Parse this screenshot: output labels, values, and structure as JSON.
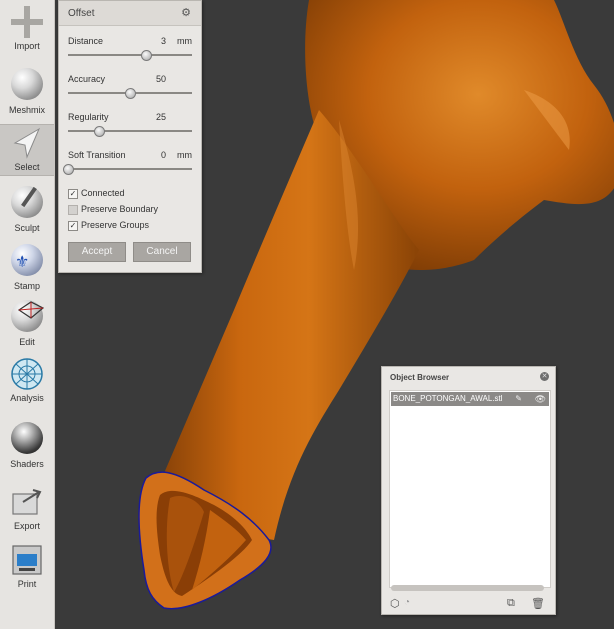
{
  "toolbar": {
    "items": [
      {
        "label": "Import",
        "icon": "plus-icon"
      },
      {
        "label": "Meshmix",
        "icon": "meshmix-icon"
      },
      {
        "label": "Select",
        "icon": "select-arrow-icon",
        "active": true
      },
      {
        "label": "Sculpt",
        "icon": "sculpt-brush-icon"
      },
      {
        "label": "Stamp",
        "icon": "stamp-icon"
      },
      {
        "label": "Edit",
        "icon": "edit-icon"
      },
      {
        "label": "Analysis",
        "icon": "analysis-icon"
      },
      {
        "label": "Shaders",
        "icon": "shaders-icon"
      },
      {
        "label": "Export",
        "icon": "export-icon"
      },
      {
        "label": "Print",
        "icon": "print-icon"
      }
    ]
  },
  "offset_panel": {
    "title": "Offset",
    "settings_icon": "gear-icon",
    "params": [
      {
        "name": "Distance",
        "value": "3",
        "unit": "mm",
        "level": 0.63
      },
      {
        "name": "Accuracy",
        "value": "50",
        "unit": "",
        "level": 0.5
      },
      {
        "name": "Regularity",
        "value": "25",
        "unit": "",
        "level": 0.25
      },
      {
        "name": "Soft Transition",
        "value": "0",
        "unit": "mm",
        "level": 0.0
      }
    ],
    "checkboxes": [
      {
        "label": "Connected",
        "checked": true
      },
      {
        "label": "Preserve Boundary",
        "checked": false
      },
      {
        "label": "Preserve Groups",
        "checked": true
      }
    ],
    "accept_label": "Accept",
    "cancel_label": "Cancel"
  },
  "object_browser": {
    "title": "Object Browser",
    "items": [
      {
        "name": "BONE_POTONGAN_AWAL.stl",
        "selected": true,
        "visible": true
      }
    ]
  },
  "colors": {
    "viewport_bg": "#3a3a3a",
    "bone": "#c0600c",
    "boundary": "#1a1a9a"
  }
}
